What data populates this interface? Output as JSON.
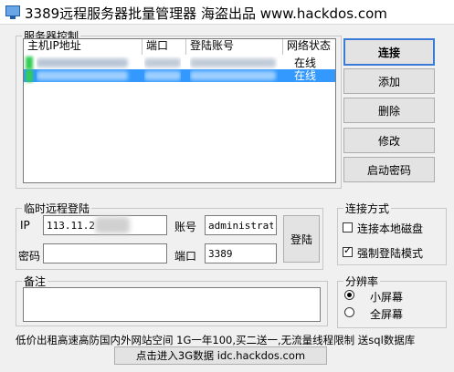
{
  "window": {
    "title": "3389远程服务器批量管理器 海盗出品 www.hackdos.com"
  },
  "server_control": {
    "legend": "服务器控制",
    "columns": [
      "主机IP地址",
      "端口",
      "登陆账号",
      "网络状态"
    ],
    "rows": [
      {
        "ip": "",
        "port": "",
        "account": "",
        "status": "在线",
        "selected": false
      },
      {
        "ip": "",
        "port": "",
        "account": "",
        "status": "在线",
        "selected": true
      }
    ]
  },
  "actions": {
    "connect": "连接",
    "add": "添加",
    "delete": "删除",
    "edit": "修改",
    "start_password": "启动密码"
  },
  "temp_login": {
    "legend": "临时远程登陆",
    "ip_label": "IP",
    "ip_value": "113.11.2",
    "account_label": "账号",
    "account_value": "administrator",
    "password_label": "密码",
    "password_value": "",
    "port_label": "端口",
    "port_value": "3389",
    "login_button": "登陆"
  },
  "connect_mode": {
    "legend": "连接方式",
    "options": [
      {
        "label": "连接本地磁盘",
        "checked": false
      },
      {
        "label": "强制登陆模式",
        "checked": true
      }
    ]
  },
  "notes": {
    "legend": "备注",
    "value": ""
  },
  "resolution": {
    "legend": "分辨率",
    "options": [
      {
        "label": "小屏幕",
        "selected": true
      },
      {
        "label": "全屏幕",
        "selected": false
      }
    ]
  },
  "ad": {
    "text": "低价出租高速高防国内外网站空间 1G一年100,买二送一,无流量线程限制 送sql数据库",
    "link_button": "点击进入3G数据 idc.hackdos.com"
  },
  "colors": {
    "selection": "#3399ff",
    "online_mark": "#33cc55",
    "default_button_border": "#3a7bd5"
  }
}
